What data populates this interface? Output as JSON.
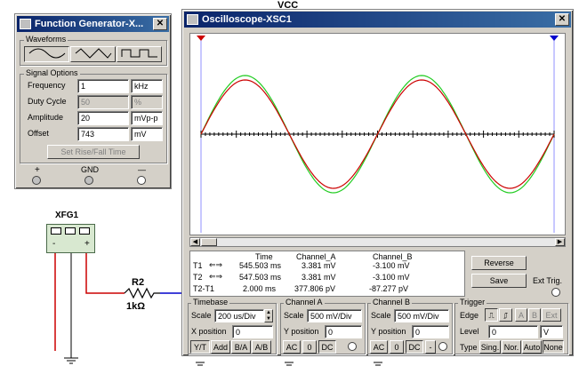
{
  "circuit": {
    "vcc_label": "VCC",
    "xfg_label": "XFG1",
    "xfg_terminals": [
      "-",
      "+"
    ],
    "resistor_name": "R2",
    "resistor_value": "1kΩ",
    "wire_color": "#cc0000",
    "probe_wire_color": "#0000cc"
  },
  "function_generator": {
    "title": "Function Generator-X...",
    "waveforms_label": "Waveforms",
    "waveform_icons": [
      "sine-wave-icon",
      "triangle-wave-icon",
      "square-wave-icon"
    ],
    "signal_options_label": "Signal Options",
    "rows": [
      {
        "label": "Frequency",
        "value": "1",
        "unit": "kHz",
        "enabled": true
      },
      {
        "label": "Duty Cycle",
        "value": "50",
        "unit": "%",
        "enabled": false
      },
      {
        "label": "Amplitude",
        "value": "20",
        "unit": "mVp-p",
        "enabled": true
      },
      {
        "label": "Offset",
        "value": "743",
        "unit": "mV",
        "enabled": true
      }
    ],
    "rise_fall_button": "Set Rise/Fall Time",
    "terminals": [
      "+",
      "GND",
      "—"
    ]
  },
  "oscilloscope": {
    "title": "Oscilloscope-XSC1",
    "screen_bg": "#ffffff",
    "trace_colors": {
      "channel_a": "#22cc22",
      "channel_b": "#cc0000"
    },
    "readout": {
      "headers": [
        "Time",
        "Channel_A",
        "Channel_B"
      ],
      "rows": [
        {
          "label": "T1",
          "time": "545.503 ms",
          "a": "3.381 mV",
          "b": "-3.100 mV"
        },
        {
          "label": "T2",
          "time": "547.503 ms",
          "a": "3.381 mV",
          "b": "-3.100 mV"
        },
        {
          "label": "T2-T1",
          "time": "2.000 ms",
          "a": "377.806 pV",
          "b": "-87.277 pV"
        }
      ]
    },
    "reverse_button": "Reverse",
    "save_button": "Save",
    "ext_trig_label": "Ext Trig.",
    "timebase": {
      "group_label": "Timebase",
      "scale_label": "Scale",
      "scale_value": "200 us/Div",
      "xpos_label": "X position",
      "xpos_value": "0",
      "mode_buttons": [
        "Y/T",
        "Add",
        "B/A",
        "A/B"
      ]
    },
    "channel_a": {
      "group_label": "Channel A",
      "scale_label": "Scale",
      "scale_value": "500 mV/Div",
      "ypos_label": "Y position",
      "ypos_value": "0",
      "coupling": [
        "AC",
        "0",
        "DC"
      ]
    },
    "channel_b": {
      "group_label": "Channel B",
      "scale_label": "Scale",
      "scale_value": "500 mV/Div",
      "ypos_label": "Y position",
      "ypos_value": "0",
      "coupling": [
        "AC",
        "0",
        "DC",
        "-"
      ]
    },
    "trigger": {
      "group_label": "Trigger",
      "edge_label": "Edge",
      "edge_buttons": [
        "A",
        "B",
        "Ext"
      ],
      "level_label": "Level",
      "level_value": "0",
      "level_unit": "V",
      "type_label": "Type",
      "type_buttons": [
        "Sing.",
        "Nor.",
        "Auto",
        "None"
      ]
    }
  }
}
